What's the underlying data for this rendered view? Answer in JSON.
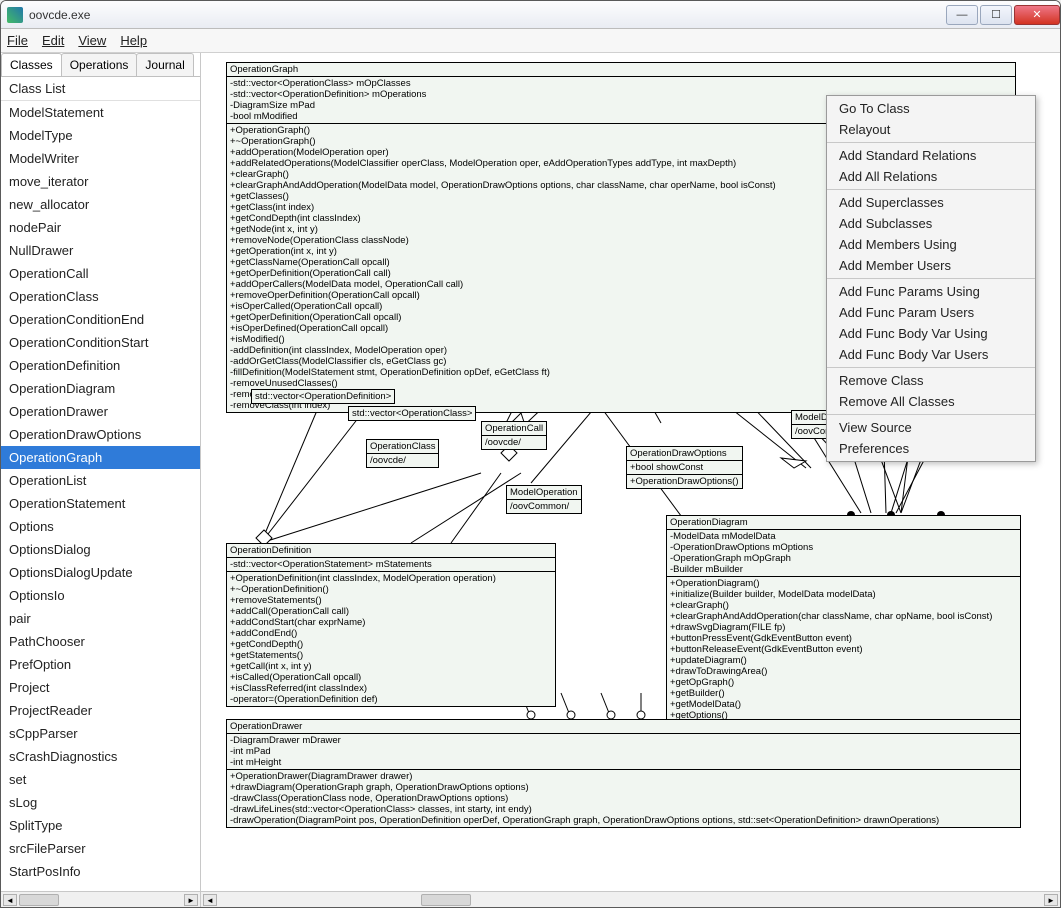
{
  "window": {
    "title": "oovcde.exe"
  },
  "menu": {
    "file": "File",
    "edit": "Edit",
    "view": "View",
    "help": "Help"
  },
  "sidebar": {
    "tabs": {
      "classes": "Classes",
      "operations": "Operations",
      "journal": "Journal"
    },
    "list_label": "Class List",
    "selected_index": 17,
    "items": [
      "ModelStatement",
      "ModelType",
      "ModelWriter",
      "move_iterator",
      "new_allocator",
      "nodePair",
      "NullDrawer",
      "OperationCall",
      "OperationClass",
      "OperationConditionEnd",
      "OperationConditionStart",
      "OperationDefinition",
      "OperationDiagram",
      "OperationDrawer",
      "OperationDrawOptions",
      "OperationGraph",
      "OperationList",
      "OperationStatement",
      "Options",
      "OptionsDialog",
      "OptionsDialogUpdate",
      "OptionsIo",
      "pair",
      "PathChooser",
      "PrefOption",
      "Project",
      "ProjectReader",
      "sCppParser",
      "sCrashDiagnostics",
      "set",
      "sLog",
      "SplitType",
      "srcFileParser",
      "StartPosInfo"
    ]
  },
  "context_menu": {
    "items": [
      "Go To Class",
      "Relayout",
      "Add Standard Relations",
      "Add All Relations",
      "Add Superclasses",
      "Add Subclasses",
      "Add Members Using",
      "Add Member Users",
      "Add Func Params Using",
      "Add Func Param Users",
      "Add Func Body Var Using",
      "Add Func Body Var Users",
      "Remove Class",
      "Remove All Classes",
      "View Source",
      "Preferences"
    ],
    "separators_after": [
      1,
      3,
      7,
      11,
      13
    ]
  },
  "diagram": {
    "OperationGraph": {
      "title": "OperationGraph",
      "attrs": [
        "-std::vector<OperationClass> mOpClasses",
        "-std::vector<OperationDefinition> mOperations",
        "-DiagramSize mPad",
        "-bool mModified"
      ],
      "ops": [
        "+OperationGraph()",
        "+~OperationGraph()",
        "+addOperation(ModelOperation oper)",
        "+addRelatedOperations(ModelClassifier operClass, ModelOperation oper, eAddOperationTypes addType, int maxDepth)",
        "+clearGraph()",
        "+clearGraphAndAddOperation(ModelData model, OperationDrawOptions options, char className, char operName, bool isConst)",
        "+getClasses()",
        "+getClass(int index)",
        "+getCondDepth(int classIndex)",
        "+getNode(int x, int y)",
        "+removeNode(OperationClass classNode)",
        "+getOperation(int x, int y)",
        "+getClassName(OperationCall opcall)",
        "+getOperDefinition(OperationCall call)",
        "+addOperCallers(ModelData model, OperationCall call)",
        "+removeOperDefinition(OperationCall opcall)",
        "+isOperCalled(OperationCall opcall)",
        "+getOperDefinition(OperationCall opcall)",
        "+isOperDefined(OperationCall opcall)",
        "+isModified()",
        "-addDefinition(int classIndex, ModelOperation oper)",
        "-addOrGetClass(ModelClassifier cls, eGetClass gc)",
        "-fillDefinition(ModelStatement stmt, OperationDefinition opDef, eGetClass ft)",
        "-removeUnusedClasses()",
        "-removeOperation(int index)",
        "-removeClass(int index)"
      ]
    },
    "vecOpDef": {
      "title": "std::vector<OperationDefinition>"
    },
    "vecOpClass": {
      "title": "std::vector<OperationClass>"
    },
    "OperationClass": {
      "title": "OperationClass",
      "attrs": [
        "/oovcde/"
      ]
    },
    "OperationCall": {
      "title": "OperationCall",
      "attrs": [
        "/oovcde/"
      ]
    },
    "ModelOperation": {
      "title": "ModelOperation",
      "attrs": [
        "/oovCommon/"
      ]
    },
    "ModelData": {
      "title": "ModelData",
      "attrs": [
        "/oovCommon/"
      ]
    },
    "OperationDrawOptions": {
      "title": "OperationDrawOptions",
      "attrs": [
        "+bool showConst"
      ],
      "ops": [
        "+OperationDrawOptions()"
      ]
    },
    "OperationDefinition": {
      "title": "OperationDefinition",
      "attrs": [
        "-std::vector<OperationStatement> mStatements"
      ],
      "ops": [
        "+OperationDefinition(int classIndex, ModelOperation operation)",
        "+~OperationDefinition()",
        "+removeStatements()",
        "+addCall(OperationCall call)",
        "+addCondStart(char exprName)",
        "+addCondEnd()",
        "+getCondDepth()",
        "+getStatements()",
        "+getCall(int x, int y)",
        "+isCalled(OperationCall opcall)",
        "+isClassReferred(int classIndex)",
        "-operator=(OperationDefinition def)"
      ]
    },
    "OperationDiagram": {
      "title": "OperationDiagram",
      "attrs": [
        "-ModelData mModelData",
        "-OperationDrawOptions mOptions",
        "-OperationGraph mOpGraph",
        "-Builder mBuilder"
      ],
      "ops": [
        "+OperationDiagram()",
        "+initialize(Builder builder, ModelData modelData)",
        "+clearGraph()",
        "+clearGraphAndAddOperation(char className, char opName, bool isConst)",
        "+drawSvgDiagram(FILE fp)",
        "+buttonPressEvent(GdkEventButton event)",
        "+buttonReleaseEvent(GdkEventButton event)",
        "+updateDiagram()",
        "+drawToDrawingArea()",
        "+getOpGraph()",
        "+getBuilder()",
        "+getModelData()",
        "+getOptions()"
      ]
    },
    "OperationDrawer": {
      "title": "OperationDrawer",
      "attrs": [
        "-DiagramDrawer mDrawer",
        "-int mPad",
        "-int mHeight"
      ],
      "ops": [
        "+OperationDrawer(DiagramDrawer drawer)",
        "+drawDiagram(OperationGraph graph, OperationDrawOptions options)",
        "-drawClass(OperationClass node, OperationDrawOptions options)",
        "-drawLifeLines(std::vector<OperationClass> classes, int starty, int endy)",
        "-drawOperation(DiagramPoint pos, OperationDefinition operDef, OperationGraph graph, OperationDrawOptions options, std::set<OperationDefinition> drawnOperations)"
      ]
    }
  }
}
